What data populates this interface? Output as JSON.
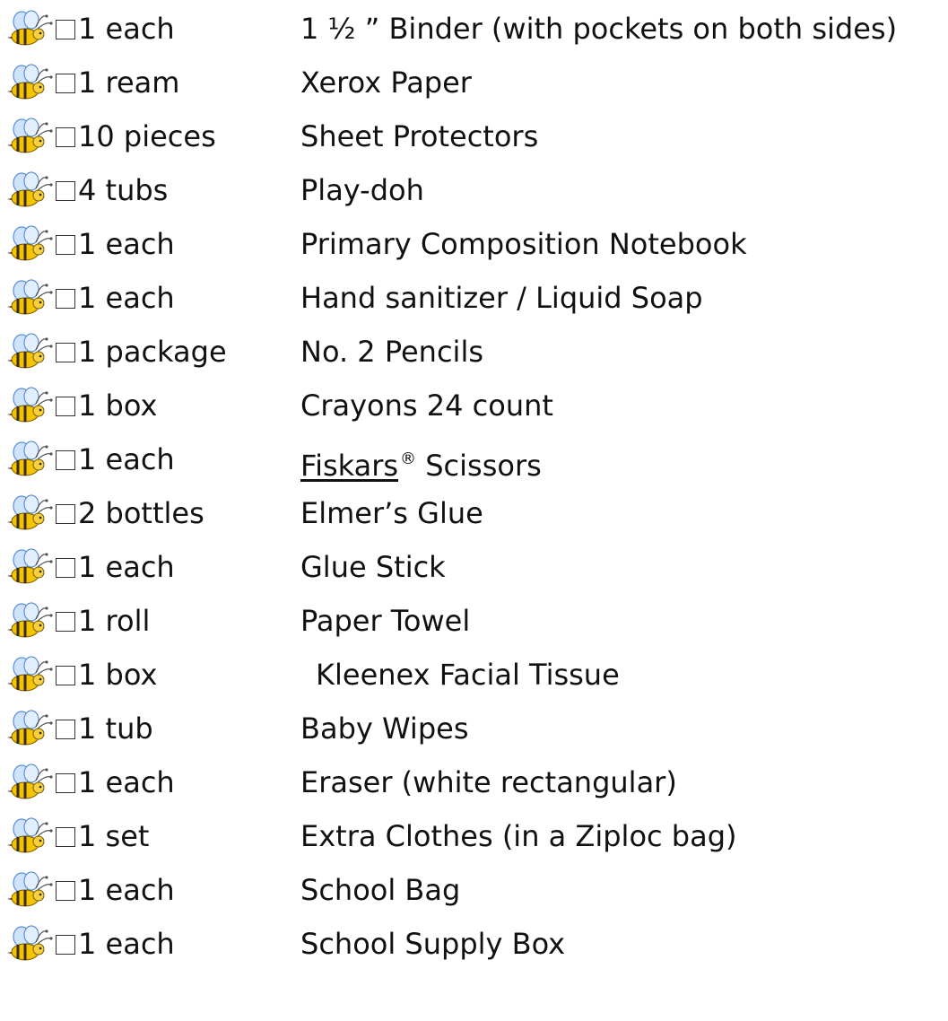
{
  "bullet_icon": "bee-icon",
  "colors": {
    "text": "#111111",
    "bee_yellow": "#f5c400",
    "bee_stripe": "#3a2a10",
    "bee_wing": "#9ec6ff",
    "checkbox_border": "#333333"
  },
  "items": [
    {
      "qty": "1 each",
      "name": "1 ½ ” Binder (with pockets on both sides)"
    },
    {
      "qty": "1 ream",
      "name": "Xerox Paper"
    },
    {
      "qty": "10 pieces",
      "name": "Sheet Protectors"
    },
    {
      "qty": "4 tubs",
      "name": "Play-doh"
    },
    {
      "qty": "1 each",
      "name": "Primary Composition Notebook"
    },
    {
      "qty": "1 each",
      "name": "Hand sanitizer / Liquid Soap"
    },
    {
      "qty": "1 package",
      "name": "No. 2 Pencils"
    },
    {
      "qty": "1 box",
      "name": "Crayons 24 count"
    },
    {
      "qty": "1 each",
      "name": "Fiskars",
      "brand_mark": "®",
      "name_rest": " Scissors"
    },
    {
      "qty": "2 bottles",
      "name": "Elmer’s Glue"
    },
    {
      "qty": "1 each",
      "name": "Glue Stick"
    },
    {
      "qty": "1 roll",
      "name": "Paper Towel"
    },
    {
      "qty": "1 box",
      "name": "Kleenex Facial Tissue"
    },
    {
      "qty": "1 tub",
      "name": "Baby Wipes"
    },
    {
      "qty": "1 each",
      "name": "Eraser (white rectangular)"
    },
    {
      "qty": "1 set",
      "name": "Extra Clothes (in a Ziploc bag)"
    },
    {
      "qty": "1 each",
      "name": "School Bag"
    },
    {
      "qty": "1 each",
      "name": "School Supply Box"
    }
  ]
}
